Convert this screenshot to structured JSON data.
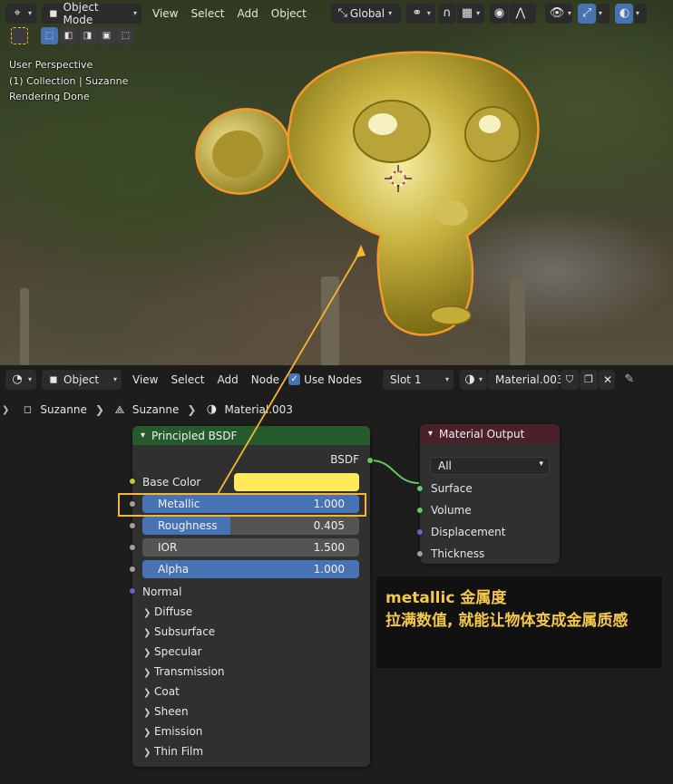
{
  "viewport": {
    "header": {
      "mode": "Object Mode",
      "menus": [
        "View",
        "Select",
        "Add",
        "Object"
      ],
      "transform_orientation": "Global"
    },
    "overlay": {
      "perspective": "User Perspective",
      "collection": "(1) Collection | Suzanne",
      "status": "Rendering Done"
    }
  },
  "node_editor": {
    "header": {
      "type": "Object",
      "menus": [
        "View",
        "Select",
        "Add",
        "Node"
      ],
      "use_nodes_label": "Use Nodes",
      "use_nodes_checked": true,
      "slot": "Slot 1",
      "material_name": "Material.003"
    },
    "breadcrumb": {
      "object": "Suzanne",
      "mesh": "Suzanne",
      "material": "Material.003"
    },
    "principled_bsdf": {
      "title": "Principled BSDF",
      "output_label": "BSDF",
      "base_color_label": "Base Color",
      "base_color_value": "#ffe85a",
      "fields": [
        {
          "label": "Metallic",
          "value": "1.000",
          "fraction": 1.0
        },
        {
          "label": "Roughness",
          "value": "0.405",
          "fraction": 0.405
        },
        {
          "label": "IOR",
          "value": "1.500",
          "fraction": 0
        },
        {
          "label": "Alpha",
          "value": "1.000",
          "fraction": 1.0
        }
      ],
      "normal_label": "Normal",
      "panels": [
        "Diffuse",
        "Subsurface",
        "Specular",
        "Transmission",
        "Coat",
        "Sheen",
        "Emission",
        "Thin Film"
      ]
    },
    "material_output": {
      "title": "Material Output",
      "target": "All",
      "inputs": [
        "Surface",
        "Volume",
        "Displacement",
        "Thickness"
      ]
    }
  },
  "annotation": {
    "line1": "metallic 金属度",
    "line2": "拉满数值, 就能让物体变成金属质感"
  },
  "colors": {
    "shader_socket": "#63c763",
    "vector_socket": "#6363c7",
    "float_socket": "#a1a1a1",
    "color_socket": "#c7c729",
    "highlight": "#f5b731",
    "accent": "#4772b3"
  }
}
